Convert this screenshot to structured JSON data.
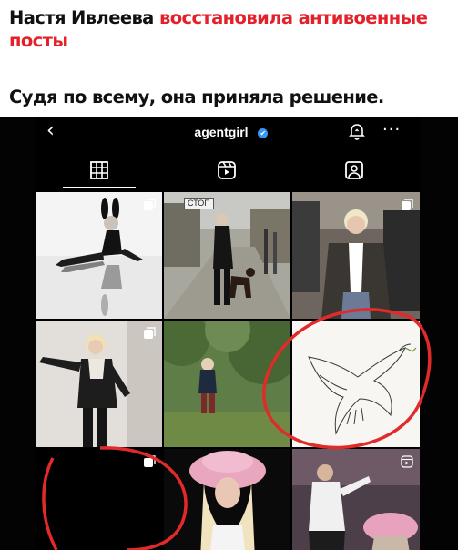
{
  "article": {
    "headline_black": "Настя Ивлеева",
    "headline_red": "восстановила антивоенные посты",
    "subheadline": "Судя по всему, она приняла решение."
  },
  "profile": {
    "username": "_agentgirl_",
    "verified_mark": "✔",
    "back_glyph": "‹",
    "more_glyph": "···",
    "icons": [
      "back-chevron-icon",
      "verified-badge-icon",
      "notification-bell-icon",
      "more-options-icon"
    ]
  },
  "tabs": [
    {
      "id": "posts",
      "icon": "grid-icon",
      "active": true
    },
    {
      "id": "reels",
      "icon": "reels-icon",
      "active": false
    },
    {
      "id": "tagged",
      "icon": "tagged-icon",
      "active": false
    }
  ],
  "grid": {
    "posts": [
      {
        "id": "post-1",
        "desc": "bunny costume reflection",
        "badge": "carousel-icon"
      },
      {
        "id": "post-2",
        "desc": "street with dog",
        "sign_text": "СТОП",
        "badge": ""
      },
      {
        "id": "post-3",
        "desc": "leather jacket by car",
        "badge": "carousel-icon"
      },
      {
        "id": "post-4",
        "desc": "leather jacket stairs",
        "badge": "carousel-icon"
      },
      {
        "id": "post-5",
        "desc": "child in garden",
        "badge": ""
      },
      {
        "id": "post-6",
        "desc": "dove drawing",
        "badge": ""
      },
      {
        "id": "post-7",
        "desc": "black square",
        "badge": "carousel-icon"
      },
      {
        "id": "post-8",
        "desc": "pink fur hat",
        "badge": ""
      },
      {
        "id": "post-9",
        "desc": "stage performance",
        "badge": "reels-icon"
      }
    ]
  },
  "colors": {
    "headline_red": "#e4202a",
    "annotation_red": "#e12a2a",
    "verified_blue": "#3897f0"
  }
}
